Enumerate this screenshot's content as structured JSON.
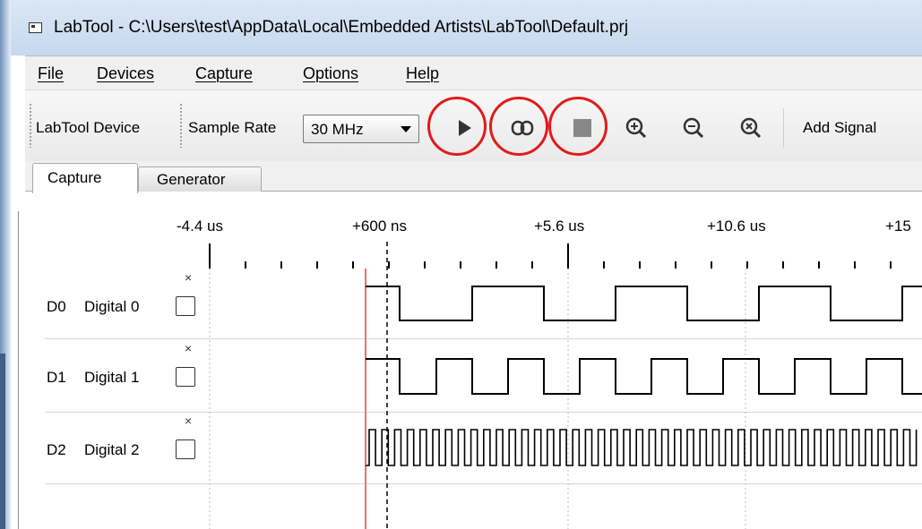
{
  "window": {
    "title": "LabTool - C:\\Users\\test\\AppData\\Local\\Embedded Artists\\LabTool\\Default.prj"
  },
  "menu": {
    "items": [
      {
        "label": "File"
      },
      {
        "label": "Devices"
      },
      {
        "label": "Capture"
      },
      {
        "label": "Options"
      },
      {
        "label": "Help"
      }
    ]
  },
  "toolbar": {
    "device_label": "LabTool Device",
    "sample_rate_label": "Sample Rate",
    "sample_rate_value": "30 MHz",
    "add_signal_label": "Add Signal",
    "highlight_color": "#e11b1b",
    "icons": [
      "play-icon",
      "continuous-icon",
      "stop-icon",
      "zoom-in-icon",
      "zoom-out-icon",
      "zoom-fit-icon"
    ]
  },
  "tabs": [
    {
      "label": "Capture",
      "active": true
    },
    {
      "label": "Generator",
      "active": false
    }
  ],
  "timeline": {
    "ticks": [
      "-4.4 us",
      "+600 ns",
      "+5.6 us",
      "+10.6 us",
      "+15"
    ],
    "trigger_color": "#f07070"
  },
  "signals": [
    {
      "id": "D0",
      "name": "Digital 0",
      "close_symbol": "×"
    },
    {
      "id": "D1",
      "name": "Digital 1",
      "close_symbol": "×"
    },
    {
      "id": "D2",
      "name": "Digital 2",
      "close_symbol": "×"
    }
  ]
}
